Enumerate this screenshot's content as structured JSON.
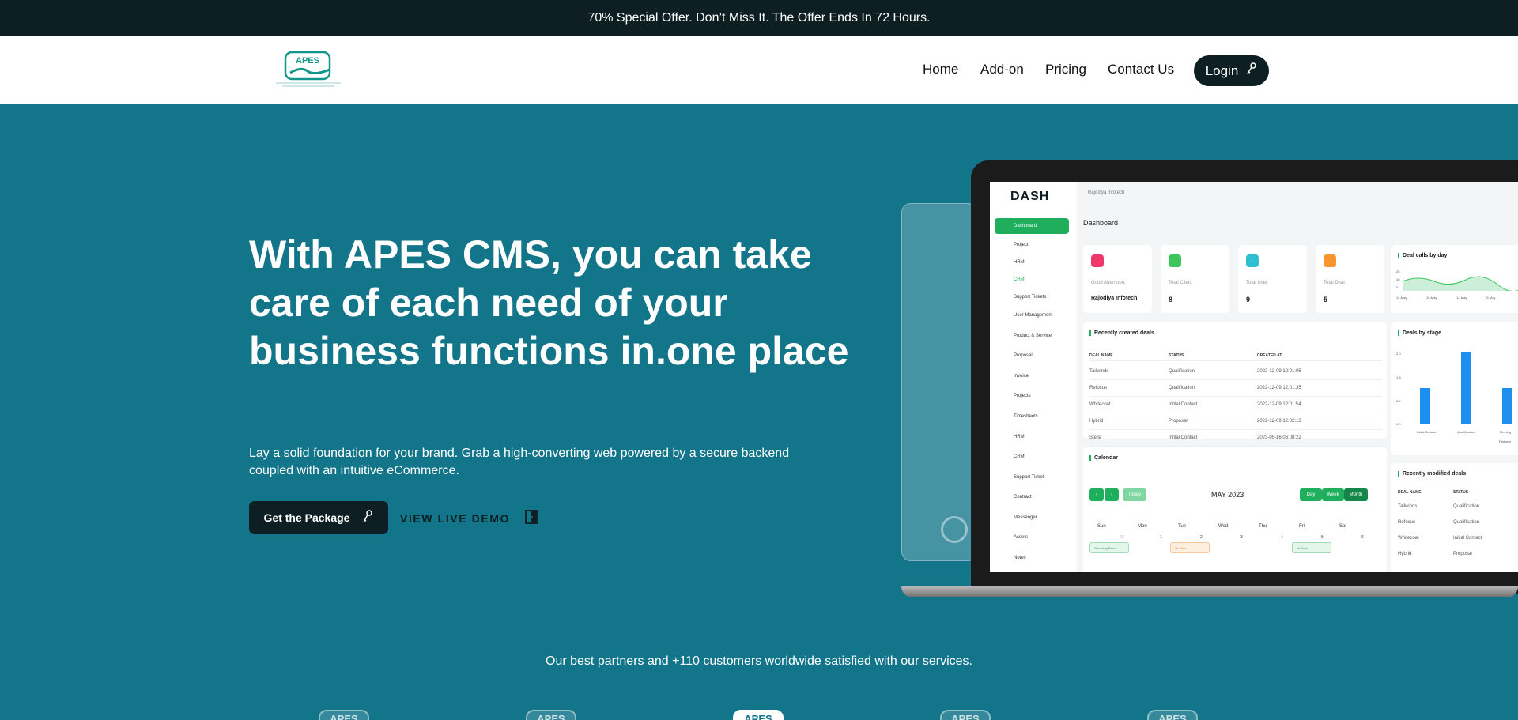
{
  "offer_bar": {
    "text": "70% Special Offer. Don’t Miss It. The Offer Ends In 72 Hours."
  },
  "header": {
    "logo_text": "APES",
    "nav": [
      "Home",
      "Add-on",
      "Pricing",
      "Contact Us"
    ],
    "login_label": "Login"
  },
  "hero": {
    "title": "With APES CMS, you can take care of each need of your business functions in.one place",
    "subtitle": "Lay a solid foundation for your brand. Grab a high-converting web powered by a secure backend coupled with an intuitive eCommerce.",
    "package_button": "Get the Package",
    "demo_link": "VIEW LIVE DEMO"
  },
  "dashboard": {
    "logo": "DASH",
    "user": "Rajodiya Infotech",
    "title": "Dashboard",
    "sidebar_active": "Dashboard",
    "sidebar_sub": [
      "Project",
      "HRM",
      "CRM",
      "Support Tickets"
    ],
    "sidebar_items": [
      "User Management",
      "Product & Service",
      "Proposal",
      "Invoice",
      "Projects",
      "Timesheets",
      "HRM",
      "CRM",
      "Support Ticket",
      "Contract",
      "Messenger",
      "Assets",
      "Notes"
    ],
    "cards": [
      {
        "label": "Good Afternoon,",
        "value": "Rajodiya Infotech",
        "color": "#f0386b"
      },
      {
        "label": "Total Client",
        "value": "8",
        "color": "#3cc65b"
      },
      {
        "label": "Total User",
        "value": "9",
        "color": "#2ec0d0"
      },
      {
        "label": "Total Deal",
        "value": "5",
        "color": "#f7962e"
      }
    ],
    "deal_calls": {
      "title": "Deal calls by day",
      "y_ticks": [
        "20",
        "10",
        "0"
      ],
      "x_ticks": [
        "14-May",
        "15-May",
        "14-May",
        "13-May"
      ]
    },
    "recent_deals": {
      "title": "Recently created deals",
      "headers": [
        "DEAL NAME",
        "STATUS",
        "CREATED AT"
      ],
      "rows": [
        [
          "Tailwinds",
          "Qualification",
          "2022-12-09 12:01:05"
        ],
        [
          "Refocus",
          "Qualification",
          "2022-12-09 12:01:35"
        ],
        [
          "Whitecoat",
          "Initial Contact",
          "2022-12-09 12:01:54"
        ],
        [
          "Hybrid",
          "Proposal",
          "2022-12-09 12:02:13"
        ],
        [
          "Stella",
          "Initial Contact",
          "2023-05-16 06:08:22"
        ]
      ]
    },
    "deals_by_stage": {
      "title": "Deals by stage",
      "y_ticks": [
        "2.0",
        "1.3",
        "0.7",
        "0.0"
      ],
      "categories": [
        "Initial Contact",
        "Qualification",
        "Meeting"
      ],
      "values": [
        1,
        2,
        1
      ],
      "legend": "Platform"
    },
    "calendar": {
      "title": "Calendar",
      "today": "Today",
      "month": "MAY 2023",
      "views": [
        "Day",
        "Week",
        "Month"
      ],
      "days": [
        "Sun",
        "Mon",
        "Tue",
        "Wed",
        "Thu",
        "Fri",
        "Sat"
      ],
      "dates": [
        "30",
        "1",
        "2",
        "3",
        "4",
        "5",
        "6"
      ],
      "events": [
        "Sampling Event",
        "Ist View",
        "Ist Sold"
      ]
    },
    "modified_deals": {
      "title": "Recently modified deals",
      "headers": [
        "DEAL NAME",
        "STATUS"
      ],
      "rows": [
        [
          "Tailwinds",
          "Qualification"
        ],
        [
          "Refocus",
          "Qualification"
        ],
        [
          "Whitecoat",
          "Initial Contact"
        ],
        [
          "Hybrid",
          "Proposal"
        ]
      ]
    }
  },
  "partners": {
    "text": "Our best partners and +110 customers worldwide satisfied with our services.",
    "logos": [
      "APES",
      "APES",
      "APES",
      "APES",
      "APES"
    ]
  }
}
